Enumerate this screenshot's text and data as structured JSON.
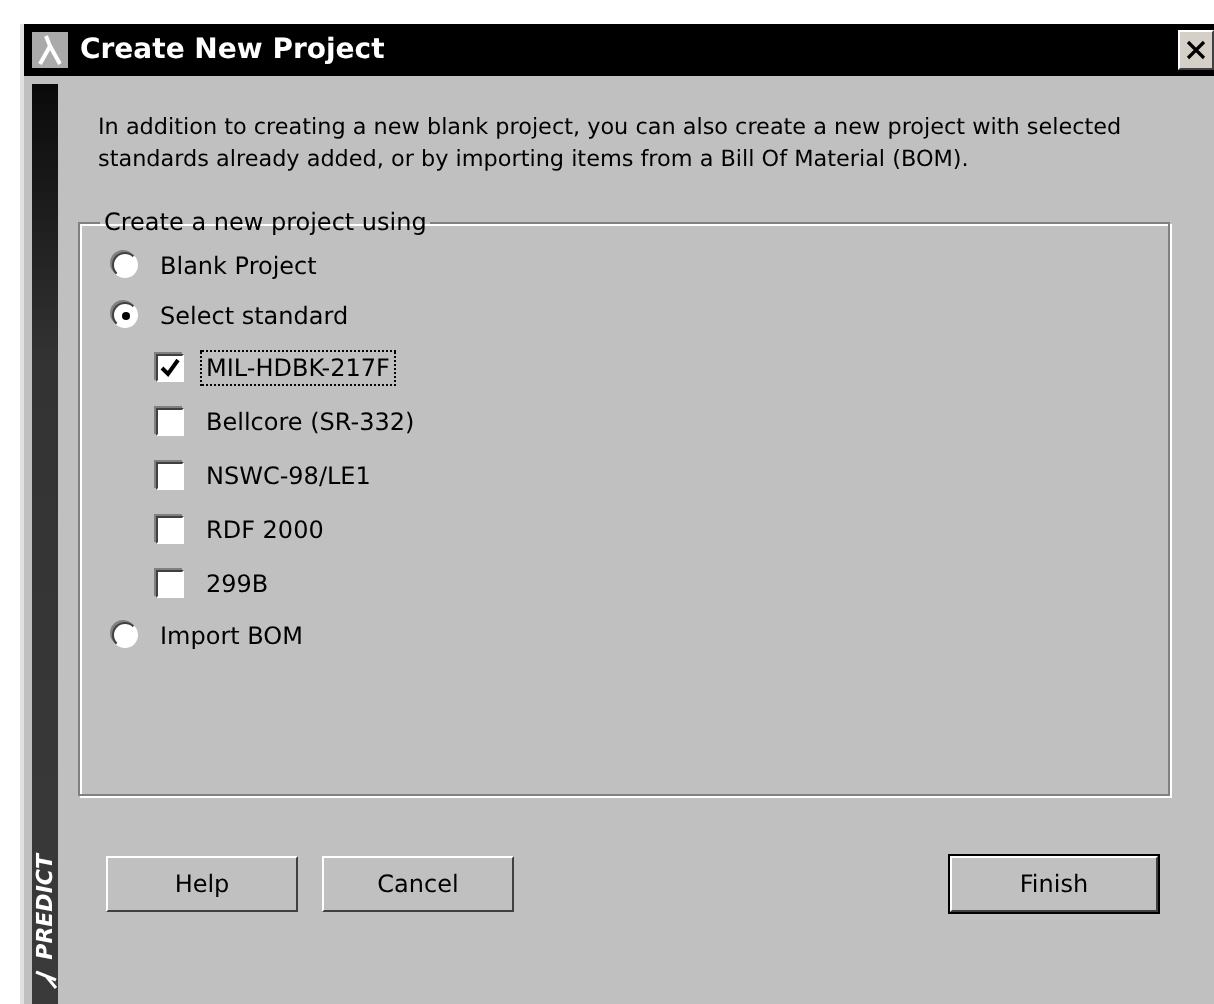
{
  "window": {
    "title": "Create New Project"
  },
  "sidebar": {
    "logo_text": "PREDICT"
  },
  "intro": "In addition to creating a new blank project, you can also create a new project with selected standards already added, or by importing items from a Bill Of Material (BOM).",
  "group": {
    "legend": "Create a new project using",
    "options": [
      {
        "kind": "radio",
        "label": "Blank Project",
        "selected": false
      },
      {
        "kind": "radio",
        "label": "Select standard",
        "selected": true
      },
      {
        "kind": "checkbox",
        "label": "MIL-HDBK-217F",
        "checked": true,
        "focused": true
      },
      {
        "kind": "checkbox",
        "label": "Bellcore (SR-332)",
        "checked": false,
        "focused": false
      },
      {
        "kind": "checkbox",
        "label": "NSWC-98/LE1",
        "checked": false,
        "focused": false
      },
      {
        "kind": "checkbox",
        "label": "RDF 2000",
        "checked": false,
        "focused": false
      },
      {
        "kind": "checkbox",
        "label": "299B",
        "checked": false,
        "focused": false
      },
      {
        "kind": "radio",
        "label": "Import BOM",
        "selected": false
      }
    ]
  },
  "left_buttons": [
    {
      "label": "Help",
      "default": false
    },
    {
      "label": "Cancel",
      "default": false
    }
  ],
  "right_buttons": [
    {
      "label": "Finish",
      "default": true
    }
  ]
}
